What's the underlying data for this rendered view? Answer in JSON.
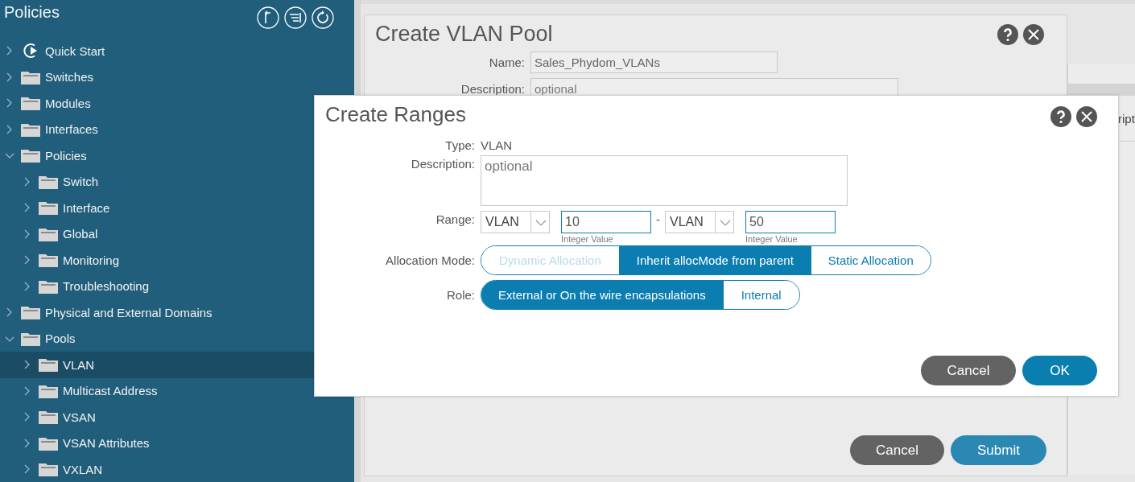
{
  "sidebar": {
    "title": "Policies",
    "items": [
      {
        "label": "Quick Start",
        "kind": "quickstart",
        "expanded": false,
        "selected": false
      },
      {
        "label": "Switches",
        "kind": "folder",
        "expanded": false,
        "selected": false
      },
      {
        "label": "Modules",
        "kind": "folder",
        "expanded": false,
        "selected": false
      },
      {
        "label": "Interfaces",
        "kind": "folder",
        "expanded": false,
        "selected": false
      },
      {
        "label": "Policies",
        "kind": "folder",
        "expanded": true,
        "selected": false,
        "children": [
          {
            "label": "Switch",
            "kind": "folder",
            "expanded": false,
            "selected": false
          },
          {
            "label": "Interface",
            "kind": "folder",
            "expanded": false,
            "selected": false
          },
          {
            "label": "Global",
            "kind": "folder",
            "expanded": false,
            "selected": false
          },
          {
            "label": "Monitoring",
            "kind": "folder",
            "expanded": false,
            "selected": false
          },
          {
            "label": "Troubleshooting",
            "kind": "folder",
            "expanded": false,
            "selected": false
          }
        ]
      },
      {
        "label": "Physical and External Domains",
        "kind": "folder",
        "expanded": false,
        "selected": false
      },
      {
        "label": "Pools",
        "kind": "folder",
        "expanded": true,
        "selected": false,
        "children": [
          {
            "label": "VLAN",
            "kind": "folder",
            "expanded": false,
            "selected": true
          },
          {
            "label": "Multicast Address",
            "kind": "folder",
            "expanded": false,
            "selected": false
          },
          {
            "label": "VSAN",
            "kind": "folder",
            "expanded": false,
            "selected": false
          },
          {
            "label": "VSAN Attributes",
            "kind": "folder",
            "expanded": false,
            "selected": false
          },
          {
            "label": "VXLAN",
            "kind": "folder",
            "expanded": false,
            "selected": false
          }
        ]
      }
    ]
  },
  "background_table": {
    "column_1_header": "ript"
  },
  "vlan_pool_dialog": {
    "title": "Create VLAN Pool",
    "fields": [
      {
        "label": "Name:",
        "value": "Sales_Phydom_VLANs"
      },
      {
        "label": "Description:",
        "placeholder": "optional"
      }
    ],
    "buttons": [
      {
        "label": "Cancel",
        "kind": "secondary"
      },
      {
        "label": "Submit",
        "kind": "primary"
      }
    ]
  },
  "ranges_dialog": {
    "title": "Create Ranges",
    "type": {
      "label": "Type:",
      "value": "VLAN"
    },
    "description": {
      "label": "Description:",
      "placeholder": "optional"
    },
    "range": {
      "label": "Range:",
      "from_type": "VLAN",
      "from_value": "10",
      "from_hint": "Integer Value",
      "separator": "-",
      "to_type": "VLAN",
      "to_value": "50",
      "to_hint": "Integer Value"
    },
    "allocation_mode": {
      "label": "Allocation Mode:",
      "options": [
        {
          "label": "Dynamic Allocation",
          "selected": false,
          "disabled": true
        },
        {
          "label": "Inherit allocMode from parent",
          "selected": true,
          "disabled": false
        },
        {
          "label": "Static Allocation",
          "selected": false,
          "disabled": false
        }
      ]
    },
    "role": {
      "label": "Role:",
      "options": [
        {
          "label": "External or On the wire encapsulations",
          "selected": true,
          "disabled": false
        },
        {
          "label": "Internal",
          "selected": false,
          "disabled": false
        }
      ]
    },
    "buttons": [
      {
        "label": "Cancel",
        "kind": "secondary"
      },
      {
        "label": "OK",
        "kind": "primary"
      }
    ]
  }
}
